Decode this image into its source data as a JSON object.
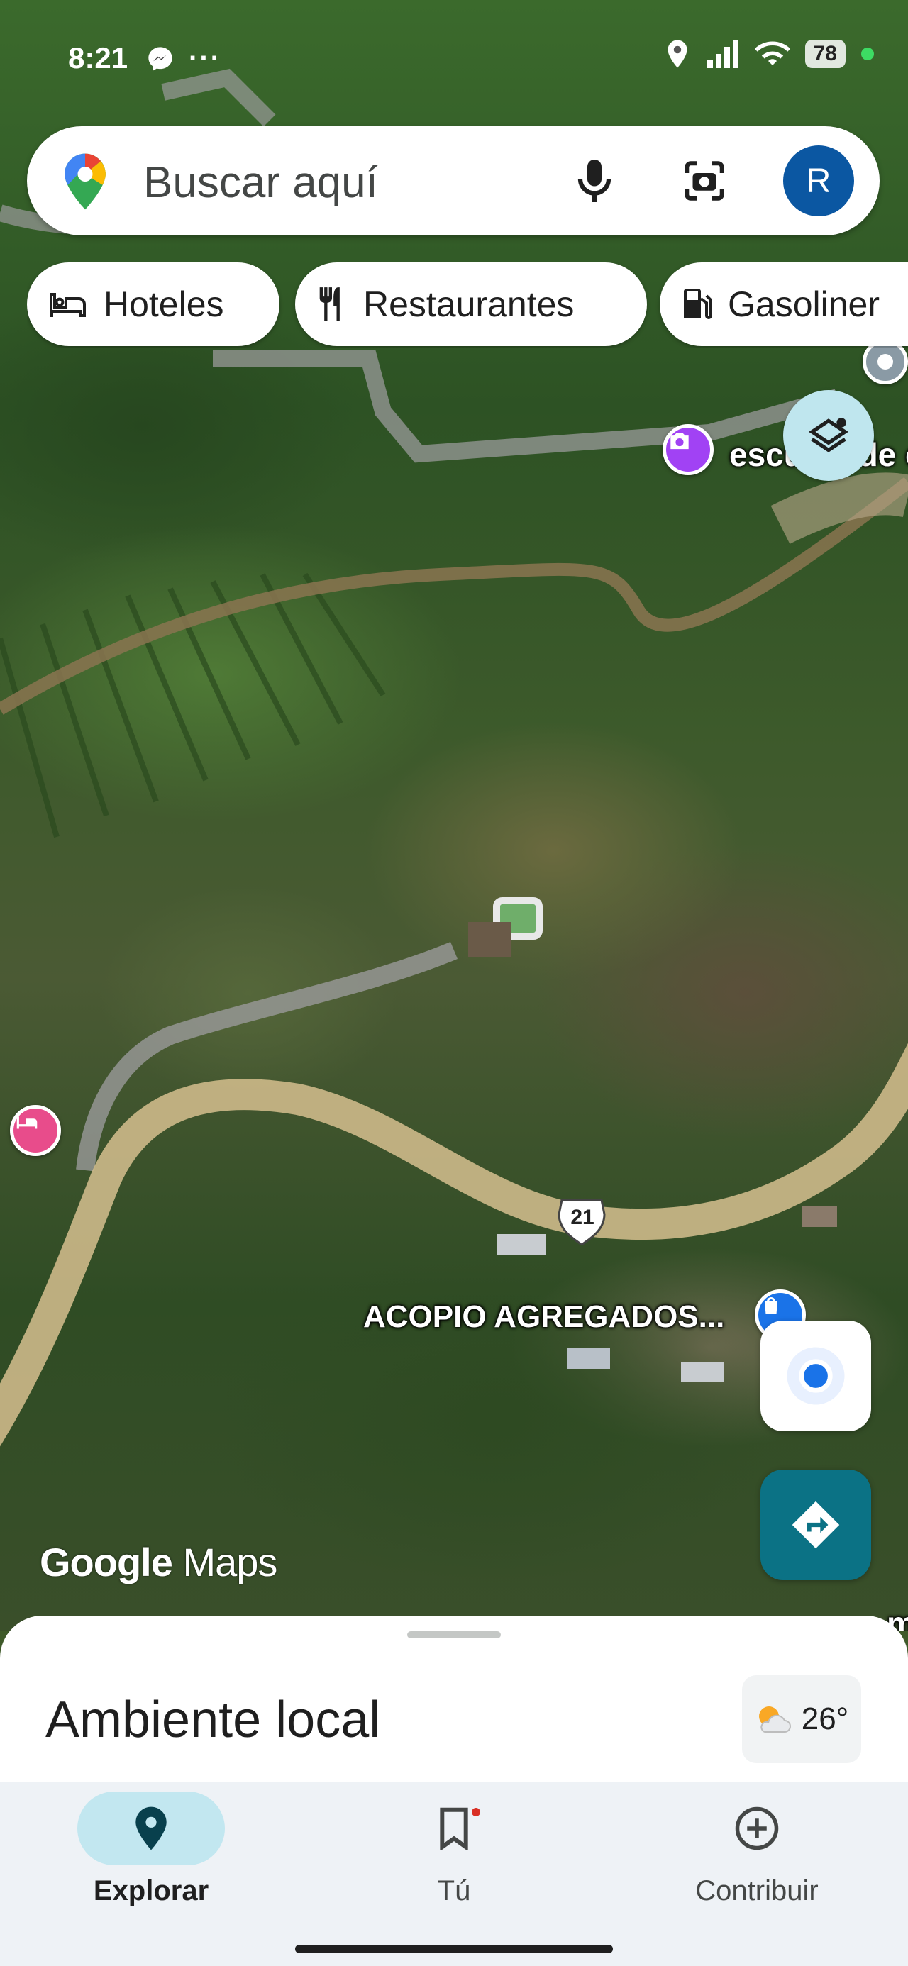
{
  "status_bar": {
    "time": "8:21",
    "battery": "78"
  },
  "search": {
    "placeholder": "Buscar aquí",
    "avatar_initial": "R"
  },
  "chips": [
    {
      "label": "Hoteles",
      "icon": "bed-icon"
    },
    {
      "label": "Restaurantes",
      "icon": "fork-knife-icon"
    },
    {
      "label": "Gasoliner",
      "icon": "gas-station-icon"
    }
  ],
  "map": {
    "labels": {
      "poi_top": "escuela de c",
      "acopio": "ACOPIO AGREGADOS...",
      "route_shield": "21",
      "bottom_right": "m"
    },
    "watermark_bold": "Google",
    "watermark_light": "Maps"
  },
  "sheet": {
    "title": "Ambiente local",
    "temperature": "26°"
  },
  "nav": {
    "explore": "Explorar",
    "you": "Tú",
    "contribute": "Contribuir"
  },
  "colors": {
    "accent": "#0b57a2",
    "directions": "#0b7285",
    "nav_active": "#c2e7f0",
    "hotel_pin": "#e84c8b",
    "photo_pin": "#a142f4",
    "shop_pin": "#1a73e8"
  }
}
